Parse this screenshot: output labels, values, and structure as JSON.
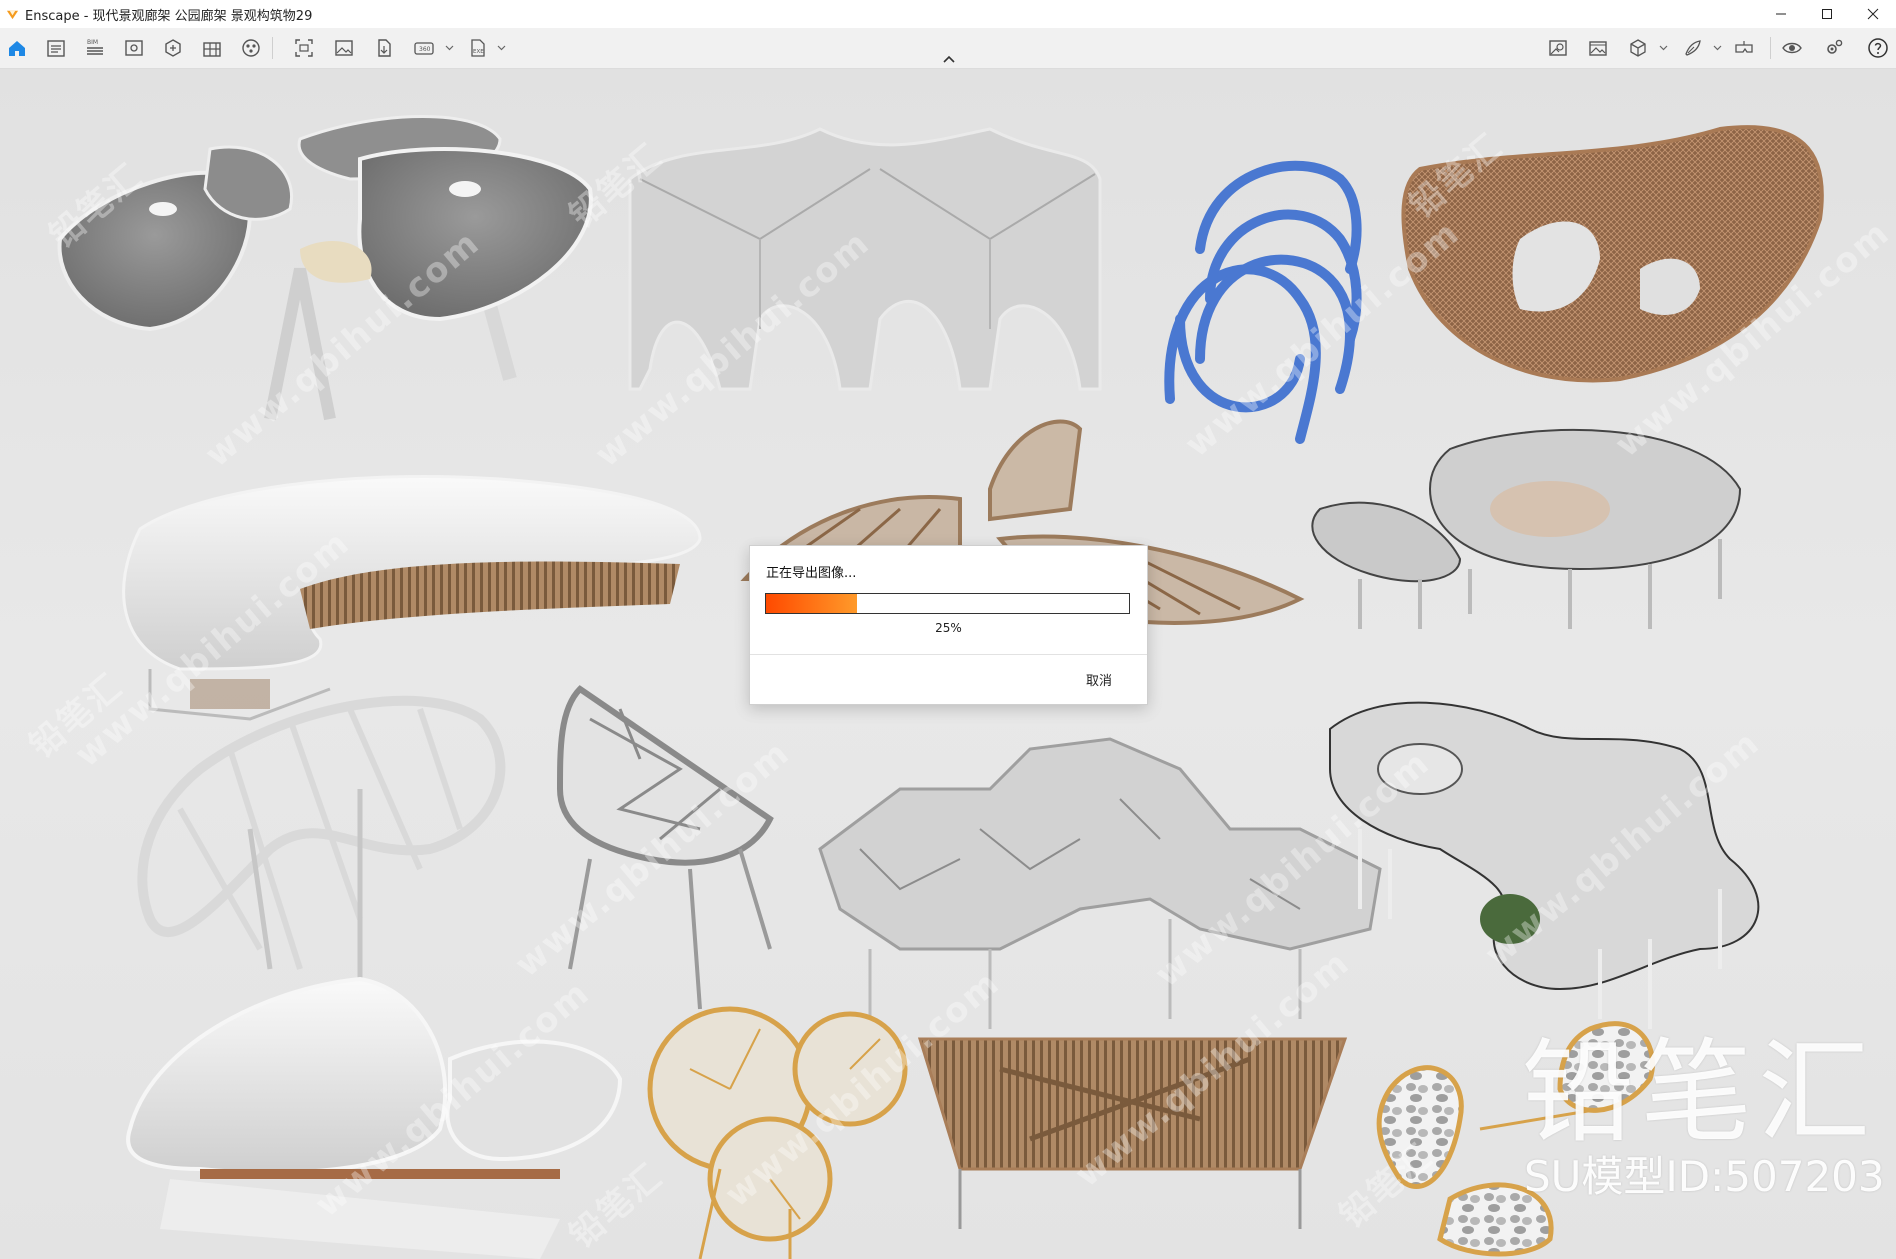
{
  "window": {
    "title": "Enscape - 现代景观廊架 公园廊架 景观构筑物29"
  },
  "toolbar": {
    "left_icons": [
      "home-icon",
      "panel-icon",
      "bim-icon",
      "view-icon",
      "assets-icon",
      "library-icon",
      "materials-icon",
      "capture-icon",
      "image-icon",
      "export-icon",
      "panorama-icon",
      "exe-export-icon"
    ],
    "right_icons": [
      "render-icon",
      "image-view-icon",
      "cube-icon",
      "brush-icon",
      "vr-headset-icon",
      "visibility-icon",
      "settings-icon",
      "help-icon"
    ],
    "bim_label": "BIM",
    "panorama_label": "360",
    "exe_label": "EXE"
  },
  "dialog": {
    "title": "正在导出图像...",
    "progress": 0.25,
    "progress_text": "25%",
    "cancel_label": "取消",
    "progress_color": "#ff6a00"
  },
  "watermark": {
    "brand": "铅笔汇",
    "model_id": "SU模型ID:507203",
    "site": "www.qbihui.com"
  }
}
